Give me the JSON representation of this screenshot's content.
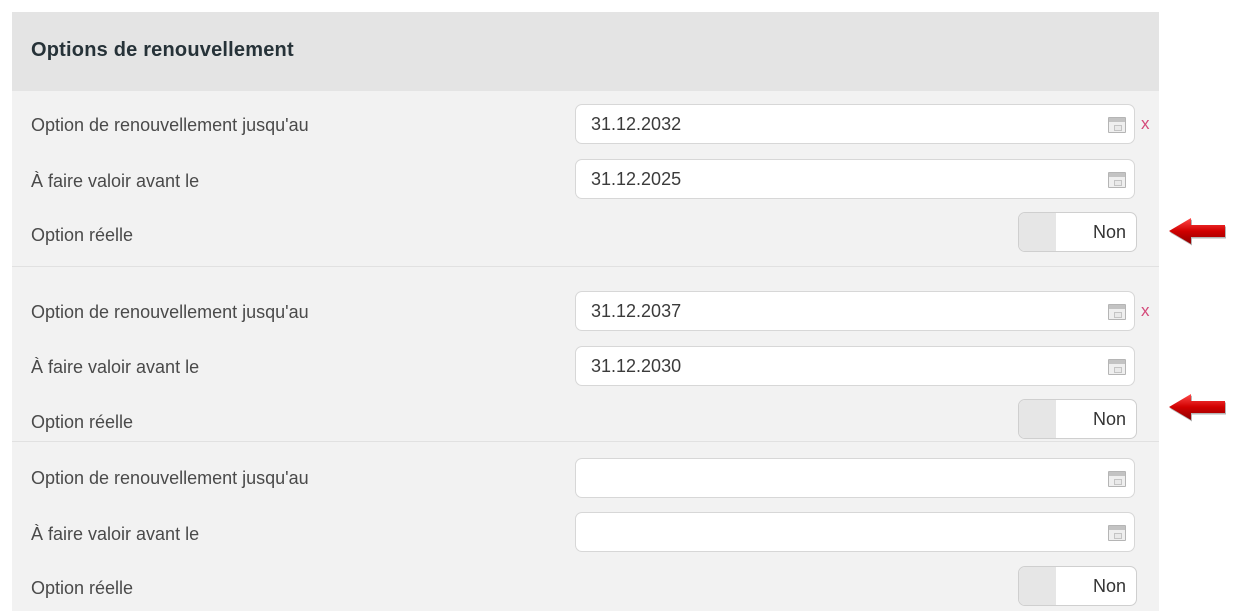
{
  "section": {
    "title": "Options de renouvellement"
  },
  "groups": [
    {
      "renewal_label": "Option de renouvellement jusqu'au",
      "renewal_value": "31.12.2032",
      "deadline_label": "À faire valoir avant le",
      "deadline_value": "31.12.2025",
      "real_option_label": "Option réelle",
      "toggle_value": "Non",
      "clear_label": "x",
      "highlighted": true
    },
    {
      "renewal_label": "Option de renouvellement jusqu'au",
      "renewal_value": "31.12.2037",
      "deadline_label": "À faire valoir avant le",
      "deadline_value": "31.12.2030",
      "real_option_label": "Option réelle",
      "toggle_value": "Non",
      "clear_label": "x",
      "highlighted": true
    },
    {
      "renewal_label": "Option de renouvellement jusqu'au",
      "renewal_value": "",
      "deadline_label": "À faire valoir avant le",
      "deadline_value": "",
      "real_option_label": "Option réelle",
      "toggle_value": "Non",
      "highlighted": false
    }
  ],
  "icons": {
    "calendar": "calendar-icon",
    "clear": "clear-icon",
    "annotation_arrow": "red-left-arrow-icon"
  },
  "colors": {
    "header_bg": "#e4e4e4",
    "panel_bg": "#f2f2f2",
    "clear_x": "#d44a7a",
    "arrow": "#cc0000"
  }
}
